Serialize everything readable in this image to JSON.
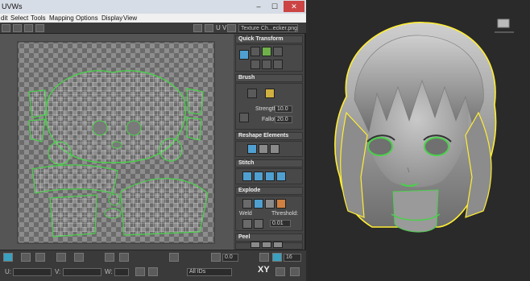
{
  "window": {
    "title": "UVWs",
    "min": "–",
    "max": "☐",
    "close": "✕"
  },
  "menu": [
    "dit",
    "Select",
    "Tools",
    "Mapping",
    "Options",
    "Display",
    "View"
  ],
  "toolbar": {
    "uv_label": "U V",
    "texture_select": "Texture Ch...ecker.png)"
  },
  "rollouts": {
    "quick_transform": "Quick Transform",
    "brush": "Brush",
    "strength_label": "Strength:",
    "strength_value": "10.0",
    "falloff_label": "Falloff:",
    "falloff_value": "20.0",
    "reshape": "Reshape Elements",
    "stitch": "Stitch",
    "explode": "Explode",
    "weld_label": "Weld",
    "threshold_label": "Threshold:",
    "threshold_value": "0.01",
    "peel": "Peel"
  },
  "bottom": {
    "u_label": "U:",
    "v_label": "V:",
    "w_label": "W:",
    "zoom_value": "0.0",
    "xy_label": "XY",
    "grid_value": "16",
    "ids_value": "All IDs"
  },
  "colors": {
    "accent": "#5bd95b",
    "highlight": "#ffff44",
    "checker_dark": "#6b6b6b",
    "checker_light": "#8d8d8d"
  },
  "icons": [
    "quick-transform-icon",
    "brush-icon",
    "reshape-icon",
    "stitch-icon",
    "explode-icon",
    "peel-icon",
    "freeform-icon",
    "zoom-icon",
    "grid-icon",
    "lock-icon"
  ]
}
